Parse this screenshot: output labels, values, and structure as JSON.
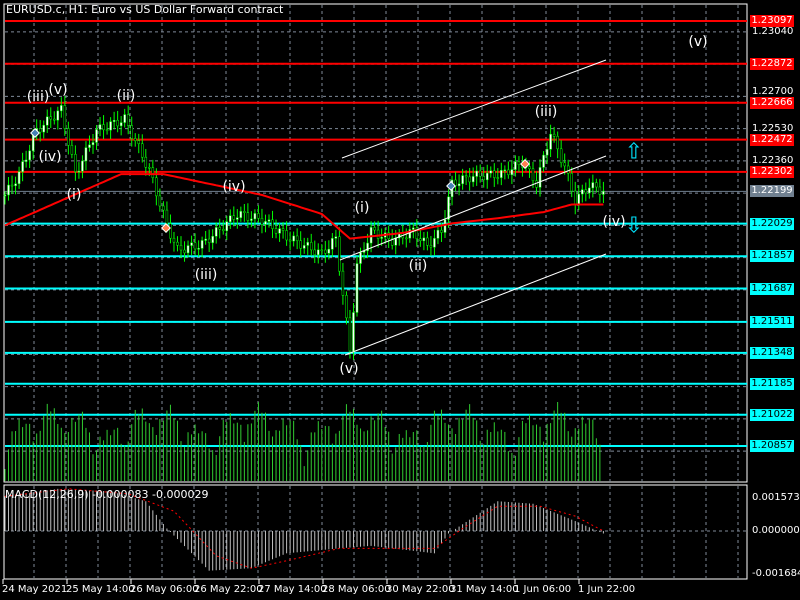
{
  "header": {
    "title": "EURUSD.c, H1:  Euro vs US Dollar Forward contract"
  },
  "macd": {
    "title": "MACD(12,26,9) -0.000083 -0.000029",
    "axis": [
      "0.001573",
      "0.000000",
      "-0.001684"
    ]
  },
  "colors": {
    "resistance": "#ff0000",
    "support": "#00ffff",
    "candle": "#00ff00",
    "ma": "#ff0000",
    "current": "#708090"
  },
  "price_axis": [
    "1.23040",
    "1.22700",
    "1.22530",
    "1.22360"
  ],
  "resistance_levels": [
    "1.23097",
    "1.22872",
    "1.22666",
    "1.22472",
    "1.22302"
  ],
  "current_price": "1.22199",
  "support_levels": [
    "1.22029",
    "1.21857",
    "1.21687",
    "1.21511",
    "1.21348",
    "1.21185",
    "1.21022",
    "1.20857"
  ],
  "time_axis": [
    "24 May 2021",
    "25 May 14:00",
    "26 May 06:00",
    "26 May 22:00",
    "27 May 14:00",
    "28 May 06:00",
    "30 May 22:00",
    "31 May 14:00",
    "1 Jun 06:00",
    "1 Jun 22:00"
  ],
  "wave_labels": [
    "(iii)",
    "(v)",
    "(ii)",
    "(iv)",
    "(i)",
    "(iv)",
    "(iii)",
    "(i)",
    "(ii)",
    "(v)",
    "(iii)",
    "(iv)",
    "(v)"
  ],
  "chart_data": {
    "type": "line",
    "price_path": [
      [
        0,
        1.2218
      ],
      [
        4,
        1.2229
      ],
      [
        9,
        1.2252
      ],
      [
        16,
        1.2263
      ],
      [
        20,
        1.2229
      ],
      [
        26,
        1.2252
      ],
      [
        34,
        1.2258
      ],
      [
        41,
        1.2231
      ],
      [
        46,
        1.2202
      ],
      [
        49,
        1.2189
      ],
      [
        56,
        1.2192
      ],
      [
        66,
        1.2208
      ],
      [
        73,
        1.2205
      ],
      [
        81,
        1.2195
      ],
      [
        90,
        1.2187
      ],
      [
        94,
        1.2195
      ],
      [
        98,
        1.2136
      ],
      [
        100,
        1.2181
      ],
      [
        104,
        1.2199
      ],
      [
        110,
        1.2194
      ],
      [
        116,
        1.2199
      ],
      [
        120,
        1.2191
      ],
      [
        124,
        1.2199
      ],
      [
        127,
        1.2224
      ],
      [
        133,
        1.2228
      ],
      [
        141,
        1.2229
      ],
      [
        147,
        1.2235
      ],
      [
        151,
        1.2224
      ],
      [
        155,
        1.2251
      ],
      [
        159,
        1.2233
      ],
      [
        162,
        1.2215
      ],
      [
        166,
        1.2223
      ],
      [
        170,
        1.222
      ]
    ],
    "ma_path": [
      [
        0,
        1.2202
      ],
      [
        33,
        1.2229
      ],
      [
        45,
        1.2229
      ],
      [
        73,
        1.2218
      ],
      [
        90,
        1.2208
      ],
      [
        98,
        1.2195
      ],
      [
        113,
        1.2198
      ],
      [
        127,
        1.2203
      ],
      [
        141,
        1.2206
      ],
      [
        153,
        1.2209
      ],
      [
        161,
        1.2213
      ],
      [
        170,
        1.2213
      ]
    ]
  }
}
